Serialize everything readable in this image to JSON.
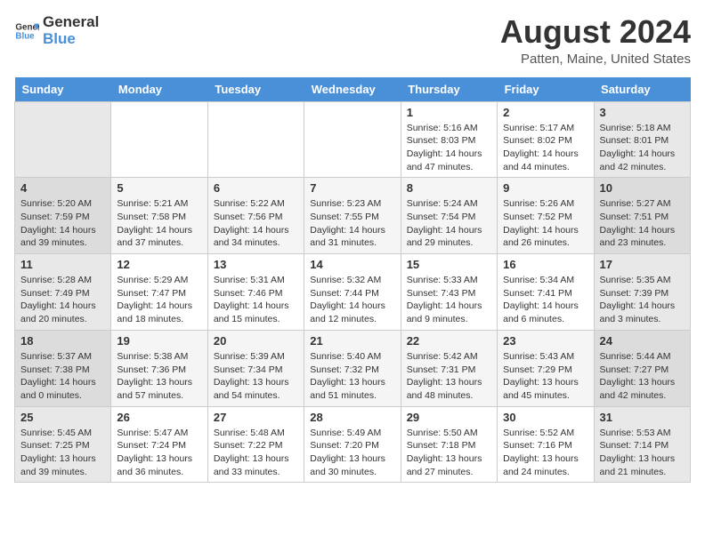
{
  "header": {
    "logo_general": "General",
    "logo_blue": "Blue",
    "month_year": "August 2024",
    "location": "Patten, Maine, United States"
  },
  "days_of_week": [
    "Sunday",
    "Monday",
    "Tuesday",
    "Wednesday",
    "Thursday",
    "Friday",
    "Saturday"
  ],
  "weeks": [
    [
      {
        "day": "",
        "info": ""
      },
      {
        "day": "",
        "info": ""
      },
      {
        "day": "",
        "info": ""
      },
      {
        "day": "",
        "info": ""
      },
      {
        "day": "1",
        "info": "Sunrise: 5:16 AM\nSunset: 8:03 PM\nDaylight: 14 hours\nand 47 minutes."
      },
      {
        "day": "2",
        "info": "Sunrise: 5:17 AM\nSunset: 8:02 PM\nDaylight: 14 hours\nand 44 minutes."
      },
      {
        "day": "3",
        "info": "Sunrise: 5:18 AM\nSunset: 8:01 PM\nDaylight: 14 hours\nand 42 minutes."
      }
    ],
    [
      {
        "day": "4",
        "info": "Sunrise: 5:20 AM\nSunset: 7:59 PM\nDaylight: 14 hours\nand 39 minutes."
      },
      {
        "day": "5",
        "info": "Sunrise: 5:21 AM\nSunset: 7:58 PM\nDaylight: 14 hours\nand 37 minutes."
      },
      {
        "day": "6",
        "info": "Sunrise: 5:22 AM\nSunset: 7:56 PM\nDaylight: 14 hours\nand 34 minutes."
      },
      {
        "day": "7",
        "info": "Sunrise: 5:23 AM\nSunset: 7:55 PM\nDaylight: 14 hours\nand 31 minutes."
      },
      {
        "day": "8",
        "info": "Sunrise: 5:24 AM\nSunset: 7:54 PM\nDaylight: 14 hours\nand 29 minutes."
      },
      {
        "day": "9",
        "info": "Sunrise: 5:26 AM\nSunset: 7:52 PM\nDaylight: 14 hours\nand 26 minutes."
      },
      {
        "day": "10",
        "info": "Sunrise: 5:27 AM\nSunset: 7:51 PM\nDaylight: 14 hours\nand 23 minutes."
      }
    ],
    [
      {
        "day": "11",
        "info": "Sunrise: 5:28 AM\nSunset: 7:49 PM\nDaylight: 14 hours\nand 20 minutes."
      },
      {
        "day": "12",
        "info": "Sunrise: 5:29 AM\nSunset: 7:47 PM\nDaylight: 14 hours\nand 18 minutes."
      },
      {
        "day": "13",
        "info": "Sunrise: 5:31 AM\nSunset: 7:46 PM\nDaylight: 14 hours\nand 15 minutes."
      },
      {
        "day": "14",
        "info": "Sunrise: 5:32 AM\nSunset: 7:44 PM\nDaylight: 14 hours\nand 12 minutes."
      },
      {
        "day": "15",
        "info": "Sunrise: 5:33 AM\nSunset: 7:43 PM\nDaylight: 14 hours\nand 9 minutes."
      },
      {
        "day": "16",
        "info": "Sunrise: 5:34 AM\nSunset: 7:41 PM\nDaylight: 14 hours\nand 6 minutes."
      },
      {
        "day": "17",
        "info": "Sunrise: 5:35 AM\nSunset: 7:39 PM\nDaylight: 14 hours\nand 3 minutes."
      }
    ],
    [
      {
        "day": "18",
        "info": "Sunrise: 5:37 AM\nSunset: 7:38 PM\nDaylight: 14 hours\nand 0 minutes."
      },
      {
        "day": "19",
        "info": "Sunrise: 5:38 AM\nSunset: 7:36 PM\nDaylight: 13 hours\nand 57 minutes."
      },
      {
        "day": "20",
        "info": "Sunrise: 5:39 AM\nSunset: 7:34 PM\nDaylight: 13 hours\nand 54 minutes."
      },
      {
        "day": "21",
        "info": "Sunrise: 5:40 AM\nSunset: 7:32 PM\nDaylight: 13 hours\nand 51 minutes."
      },
      {
        "day": "22",
        "info": "Sunrise: 5:42 AM\nSunset: 7:31 PM\nDaylight: 13 hours\nand 48 minutes."
      },
      {
        "day": "23",
        "info": "Sunrise: 5:43 AM\nSunset: 7:29 PM\nDaylight: 13 hours\nand 45 minutes."
      },
      {
        "day": "24",
        "info": "Sunrise: 5:44 AM\nSunset: 7:27 PM\nDaylight: 13 hours\nand 42 minutes."
      }
    ],
    [
      {
        "day": "25",
        "info": "Sunrise: 5:45 AM\nSunset: 7:25 PM\nDaylight: 13 hours\nand 39 minutes."
      },
      {
        "day": "26",
        "info": "Sunrise: 5:47 AM\nSunset: 7:24 PM\nDaylight: 13 hours\nand 36 minutes."
      },
      {
        "day": "27",
        "info": "Sunrise: 5:48 AM\nSunset: 7:22 PM\nDaylight: 13 hours\nand 33 minutes."
      },
      {
        "day": "28",
        "info": "Sunrise: 5:49 AM\nSunset: 7:20 PM\nDaylight: 13 hours\nand 30 minutes."
      },
      {
        "day": "29",
        "info": "Sunrise: 5:50 AM\nSunset: 7:18 PM\nDaylight: 13 hours\nand 27 minutes."
      },
      {
        "day": "30",
        "info": "Sunrise: 5:52 AM\nSunset: 7:16 PM\nDaylight: 13 hours\nand 24 minutes."
      },
      {
        "day": "31",
        "info": "Sunrise: 5:53 AM\nSunset: 7:14 PM\nDaylight: 13 hours\nand 21 minutes."
      }
    ]
  ]
}
